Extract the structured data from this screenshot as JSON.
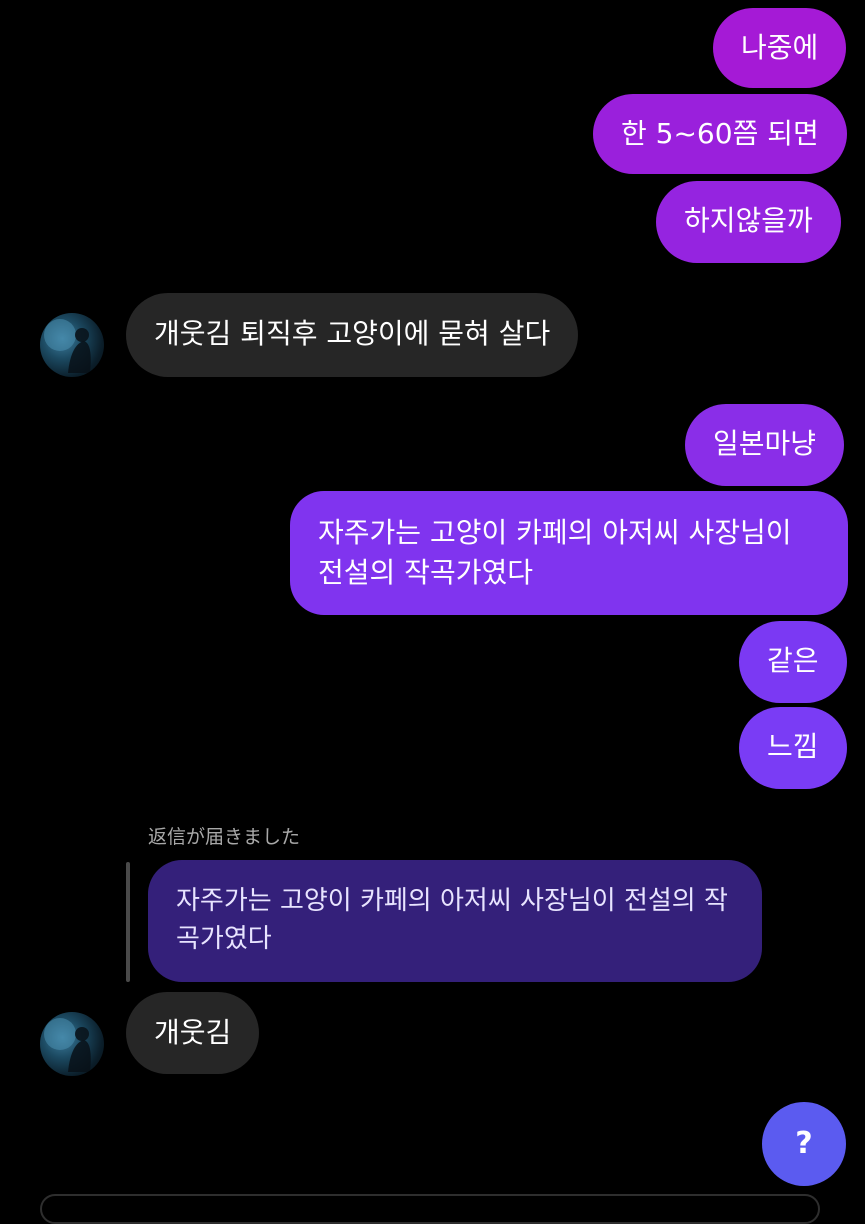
{
  "messages": {
    "m1": "나중에",
    "m2": "한 5~60쯤 되면",
    "m3": "하지않을까",
    "m4": "개웃김 퇴직후 고양이에 묻혀 살다",
    "m5": "일본마냥",
    "m6": "자주가는 고양이 카페의 아저씨 사장님이 전설의 작곡가였다",
    "m7": "같은",
    "m8": "느낌",
    "m9": "개웃김"
  },
  "reply": {
    "label": "返信が届きました",
    "quoted_text": "자주가는 고양이 카페의 아저씨 사장님이 전설의 작곡가였다"
  },
  "help_button": {
    "label": "?"
  },
  "colors": {
    "background": "#000000",
    "incoming_bubble": "#262626",
    "outgoing_top": "#a21bd8",
    "outgoing_bottom": "#7a3cf5",
    "reply_bubble": "#34207a",
    "help_button": "#5b5bf0"
  },
  "icons": {
    "avatar": "profile-photo",
    "help": "question-mark"
  }
}
